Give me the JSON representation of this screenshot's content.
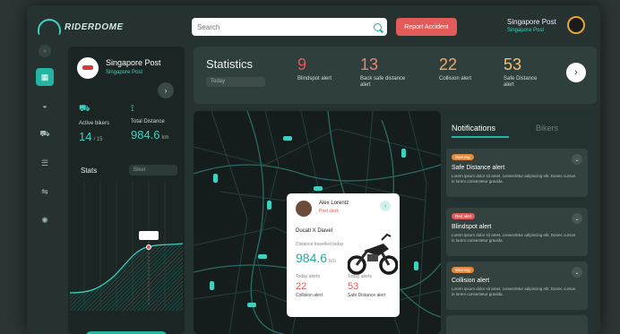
{
  "header": {
    "logo_text": "RIDERDOME",
    "search_placeholder": "Search",
    "report_label": "Report Accident",
    "user_name": "Singapore Post",
    "user_role": "Singapore Post"
  },
  "sidebar": {
    "items": [
      "dashboard-icon",
      "helmet-icon",
      "motorbike-icon",
      "list-icon",
      "settings-sliders-icon",
      "gear-icon"
    ]
  },
  "company": {
    "name": "Singapore Post",
    "subtitle": "Singapore Post",
    "active_bikers_label": "Active bikers",
    "active_bikers_value": "14",
    "active_bikers_total": "/ 15",
    "total_distance_label": "Total Distance",
    "total_distance_value": "984.6",
    "total_distance_unit": "km",
    "stats_label": "Stats",
    "stats_select": "Biker"
  },
  "statistics": {
    "title": "Statistics",
    "period": "Today",
    "items": [
      {
        "num": "9",
        "label": "Blindspot alert",
        "color": "#e25a5a"
      },
      {
        "num": "13",
        "label": "Back safe distance alert",
        "color": "#e9837a"
      },
      {
        "num": "22",
        "label": "Collision alert",
        "color": "#f0a86a"
      },
      {
        "num": "53",
        "label": "Safe Distance alert",
        "color": "#f2c27a"
      }
    ]
  },
  "popup": {
    "name": "Alex Lorentz",
    "role": "Post clerk",
    "bike": "Ducati X Diavel",
    "distance_label": "Distance travelled today",
    "distance_value": "984.6",
    "distance_unit": "km",
    "alerts": [
      {
        "label": "Today alerts",
        "num": "22",
        "text": "Collision alert"
      },
      {
        "label": "Today alerts",
        "num": "53",
        "text": "Safe Distance alert"
      }
    ]
  },
  "notifications": {
    "tab_active": "Notifications",
    "tab_other": "Bikers",
    "cards": [
      {
        "tag": "Warning",
        "tag_color": "#e5883b",
        "title": "Safe Distance alert",
        "text": "Lorem ipsum dolor sit amet, consectetur adipiscing elit. Donec cursus in lorem consectetur gravida."
      },
      {
        "tag": "Red alert",
        "tag_color": "#e25a5a",
        "title": "Blindspot alert",
        "text": "Lorem ipsum dolor sit amet, consectetur adipiscing elit. Donec cursus in lorem consectetur gravida."
      },
      {
        "tag": "Warning",
        "tag_color": "#e5883b",
        "title": "Collision alert",
        "text": "Lorem ipsum dolor sit amet, consectetur adipiscing elit. Donec cursus in lorem consectetur gravida."
      }
    ]
  }
}
